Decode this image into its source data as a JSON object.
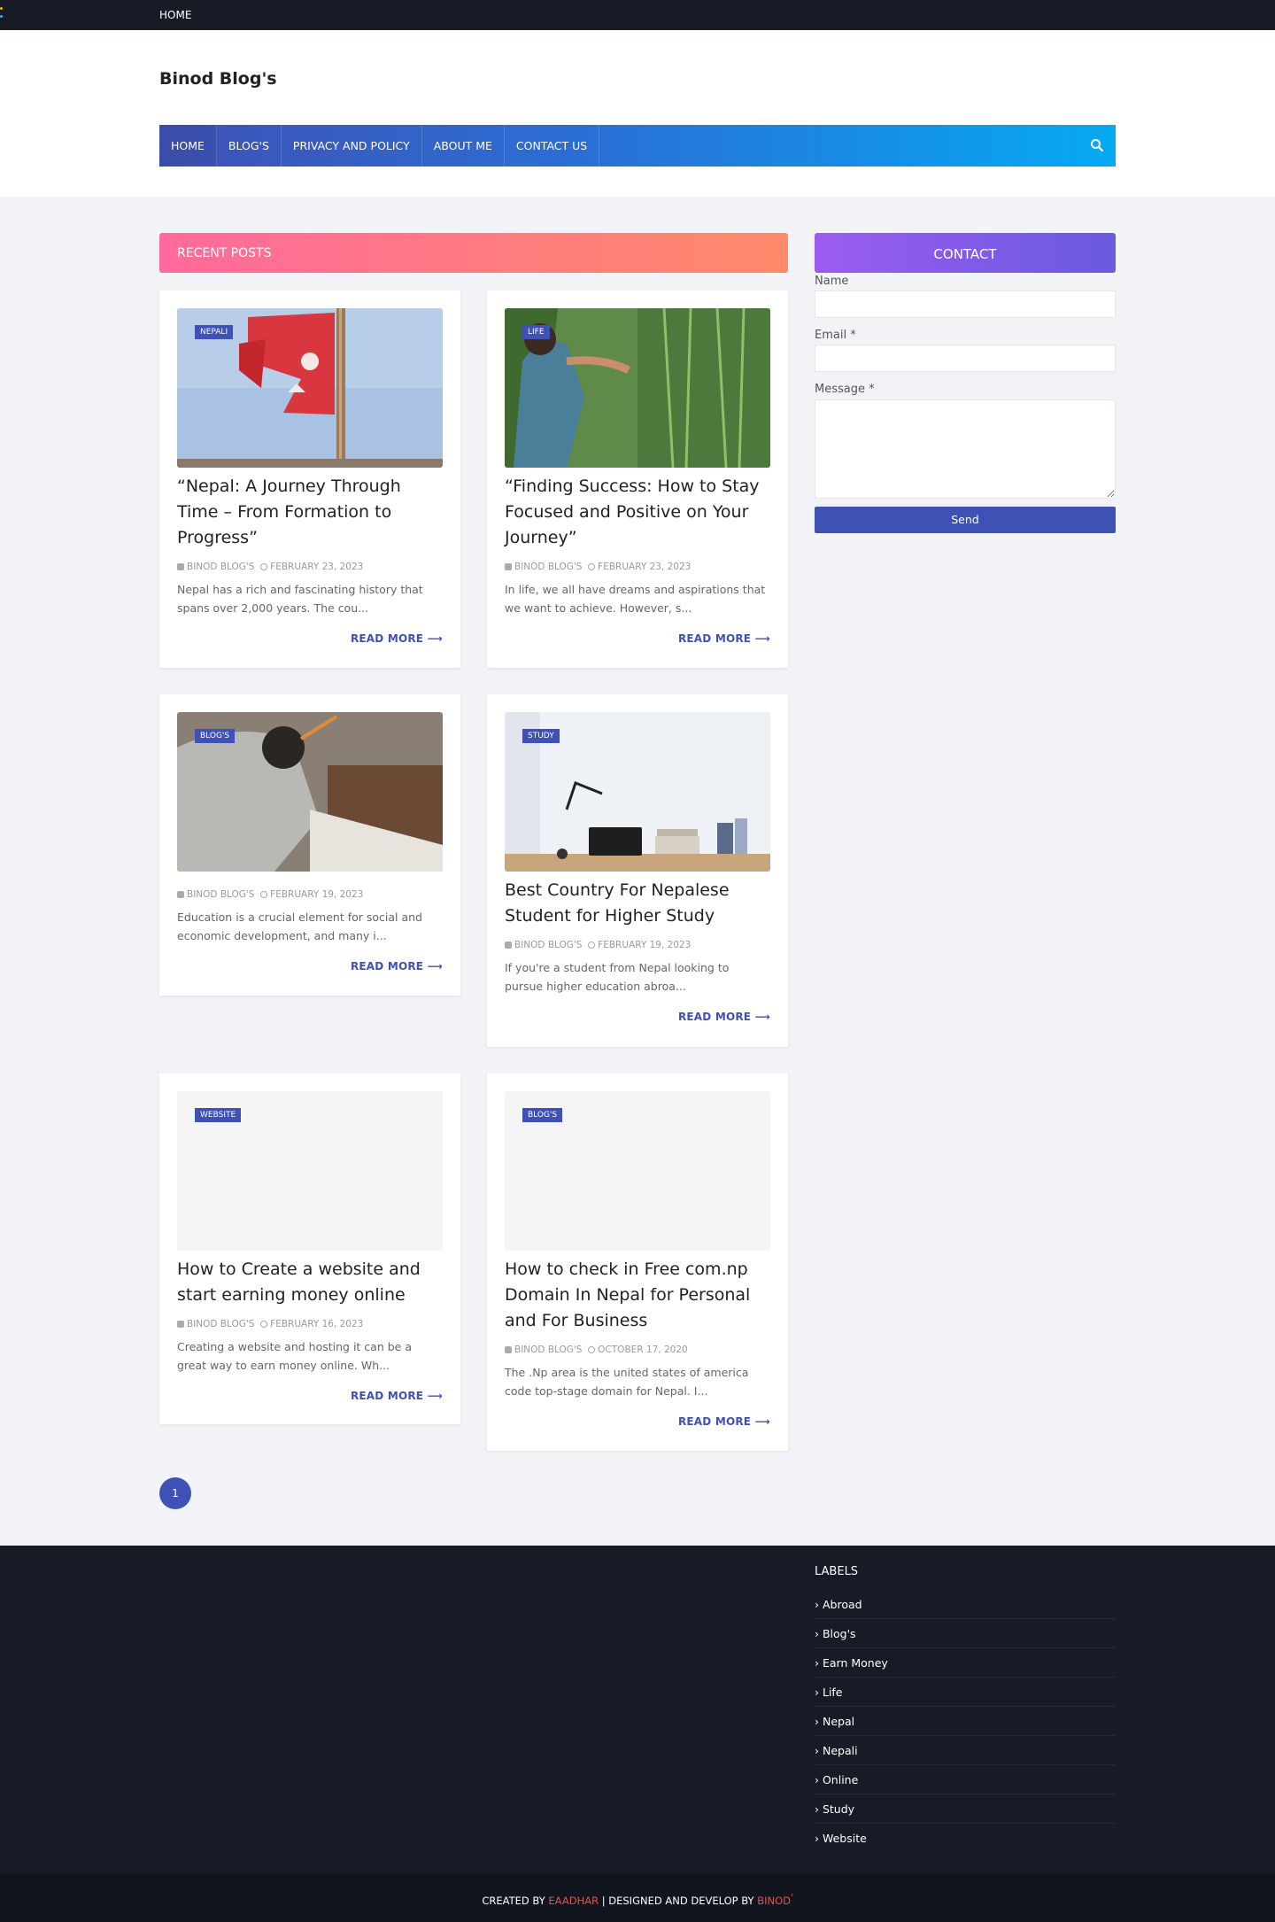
{
  "topbar": {
    "home": "HOME"
  },
  "header": {
    "brand": "Binod Blog's"
  },
  "nav": {
    "items": [
      "HOME",
      "BLOG'S",
      "PRIVACY AND POLICY",
      "ABOUT ME",
      "CONTACT US"
    ],
    "search_icon": "search-icon"
  },
  "recent": {
    "title": "RECENT POSTS"
  },
  "posts": [
    {
      "tag": "NEPALI",
      "title": "“Nepal: A Journey Through Time – From Formation to Progress”",
      "author": "BINOD BLOG'S",
      "date": "FEBRUARY 23, 2023",
      "excerpt": "Nepal has a rich and fascinating history that spans over 2,000 years. The cou...",
      "more": "READ MORE"
    },
    {
      "tag": "LIFE",
      "title": "“Finding Success: How to Stay Focused and Positive on Your Journey”",
      "author": "BINOD BLOG'S",
      "date": "FEBRUARY 23, 2023",
      "excerpt": "In life, we all have dreams and aspirations that we want to achieve. However, s...",
      "more": "READ MORE"
    },
    {
      "tag": "BLOG'S",
      "title": "",
      "author": "BINOD BLOG'S",
      "date": "FEBRUARY 19, 2023",
      "excerpt": "Education is a crucial element for social and economic development, and many i...",
      "more": "READ MORE"
    },
    {
      "tag": "STUDY",
      "title": "Best Country For Nepalese Student for Higher Study",
      "author": "BINOD BLOG'S",
      "date": "FEBRUARY 19, 2023",
      "excerpt": "If you're a student from Nepal looking to pursue higher education abroa...",
      "more": "READ MORE"
    },
    {
      "tag": "WEBSITE",
      "title": "How to Create a website and start earning money online",
      "author": "BINOD BLOG'S",
      "date": "FEBRUARY 16, 2023",
      "excerpt": "Creating a website and hosting it can be a great way to earn money online. Wh...",
      "more": "READ MORE"
    },
    {
      "tag": "BLOG'S",
      "title": "How to check in Free com.np Domain In Nepal for Personal and For Business",
      "author": "BINOD BLOG'S",
      "date": "OCTOBER 17, 2020",
      "excerpt": "The .Np area is the united states of america code top-stage domain for Nepal. I...",
      "more": "READ MORE"
    }
  ],
  "contact": {
    "title": "CONTACT",
    "name_label": "Name",
    "email_label": "Email *",
    "message_label": "Message *",
    "send": "Send"
  },
  "pagination": {
    "current": "1"
  },
  "footer": {
    "labels_title": "LABELS",
    "labels": [
      "› Abroad",
      "› Blog's",
      "› Earn Money",
      "› Life",
      "› Nepal",
      "› Nepali",
      "› Online",
      "› Study",
      "› Website"
    ],
    "credit_prefix": "CREATED BY ",
    "credit_name": "EAADHAR",
    "credit_middle": " | DESIGNED AND DEVELOP BY ",
    "credit_author": "BINOD",
    "credit_mark": "'"
  },
  "colors": {
    "nav_start": "#3f51b5",
    "nav_end": "#06a9f3",
    "accent": "#3f51b5",
    "recent_start": "#ff6a9b",
    "recent_end": "#ff8a6a",
    "contact_start": "#9b5cf0",
    "contact_end": "#6a5ae0",
    "footer_bg": "#161b26",
    "credit_red": "#f04b4b"
  }
}
